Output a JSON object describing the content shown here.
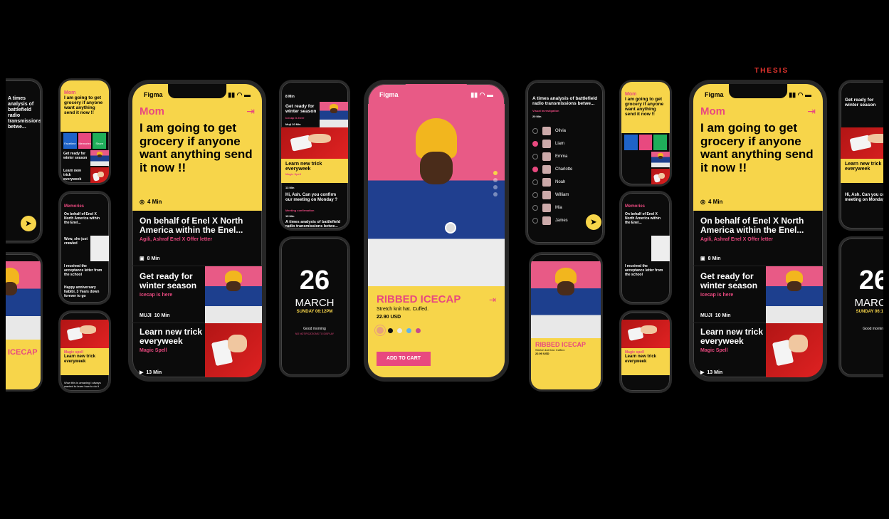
{
  "brand": "THESIS",
  "status": {
    "app": "Figma",
    "icons": "▮▮ ◠ ▬"
  },
  "p_mom": {
    "from": "Mom",
    "message": "I am going to get grocery if anyone want anything send it now !!",
    "time": "4 Min",
    "enel_title": "On behalf of Enel X North America within the Enel...",
    "enel_sub": "Agili, Ashraf Enel X Offer letter",
    "enel_time": "8 Min",
    "winter_title": "Get ready for winter season",
    "winter_sub": "Icecap is here",
    "winter_time": "10 Min",
    "winter_brand": "MUJI",
    "trick_title": "Learn new trick everyweek",
    "trick_sub": "Magic Spell",
    "trick_time": "13 Min"
  },
  "p_feed": {
    "time1": "8 Min",
    "winter_title": "Get ready for winter season",
    "winter_sub": "Icecap is here",
    "winter_time": "Muji 10 Min",
    "trick_title": "Learn new trick everyweek",
    "trick_sub": "Magic Spell",
    "trick_time": "13 Min",
    "meeting": "Hi, Ash. Can you confirm our meeting on Monday ?",
    "meeting_sub": "Meeting confirmation",
    "meeting_time": "15 Min",
    "times": "A times analysis of battlefield radio transmissions betwe..."
  },
  "p_lock": {
    "day": "26",
    "month": "MARCH",
    "datetime": "SUNDAY 06:12PM",
    "greeting": "Good morning",
    "note": "NO NOTIFICATIONS TO DISPLAY"
  },
  "p_product": {
    "name": "RIBBED ICECAP",
    "desc": "Stretch knit hat. Cuffed.",
    "price": "22.90 USD",
    "cta": "ADD TO CART",
    "swatches": [
      "#e8a07a",
      "#111111",
      "#e8e8e8",
      "#5fb4e8",
      "#c84a8a"
    ]
  },
  "p_list": {
    "title": "A times analysis of battlefield radio transmissions betwe...",
    "sub": "Visual Investigation",
    "time": "20 Min",
    "people": [
      "Olivia",
      "Liam",
      "Emma",
      "Charlotte",
      "Noah",
      "William",
      "Mia",
      "James"
    ],
    "selected": [
      false,
      true,
      false,
      true,
      false,
      false,
      false,
      false
    ]
  },
  "p_memories": {
    "header": "Memories",
    "enel": "On behalf of Enel X North America within the Enel...",
    "wow": "Wow, she just crawled",
    "accept": "I received the acceptance letter from the school",
    "habits": "Happy anniversary habibi, 3 Years down forever to go"
  },
  "p_magic": {
    "header": "Magic spell",
    "title": "Learn new trick everyweek",
    "comment": "Wow this is amazing i always wanted to learn how to do it"
  },
  "p_small_mom": {
    "from": "Mom",
    "message": "I am going to get grocery if anyone want anything send it now !!",
    "actions": [
      "Facetime",
      "Memories",
      "Share"
    ],
    "winter": "Get ready for winter season",
    "trick": "Learn new trick everyweek"
  },
  "p_partial": {
    "times": "A times analysis of battlefield radio transmissions betwe...",
    "icecap": "ICECAP"
  }
}
